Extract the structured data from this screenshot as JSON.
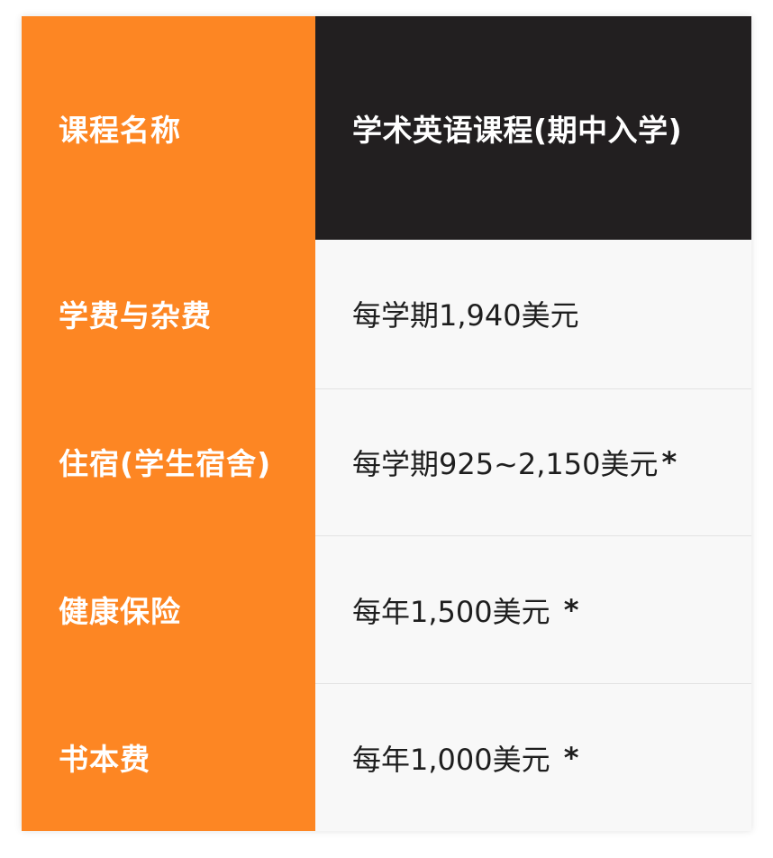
{
  "table": {
    "header": {
      "label": "课程名称",
      "value": "学术英语课程(期中入学)"
    },
    "rows": [
      {
        "label": "学费与杂费",
        "value": "每学期1,940美元",
        "marker": ""
      },
      {
        "label": "住宿(学生宿舍)",
        "value": "每学期925~2,150美元",
        "marker": "*"
      },
      {
        "label": "健康保险",
        "value": "每年1,500美元",
        "marker": " *"
      },
      {
        "label": "书本费",
        "value": "每年1,000美元",
        "marker": " *"
      }
    ]
  },
  "colors": {
    "label_column_bg": "#fd8623",
    "header_value_bg": "#221f20",
    "value_cell_bg": "#f8f8f8",
    "divider": "#e3e3e3"
  }
}
